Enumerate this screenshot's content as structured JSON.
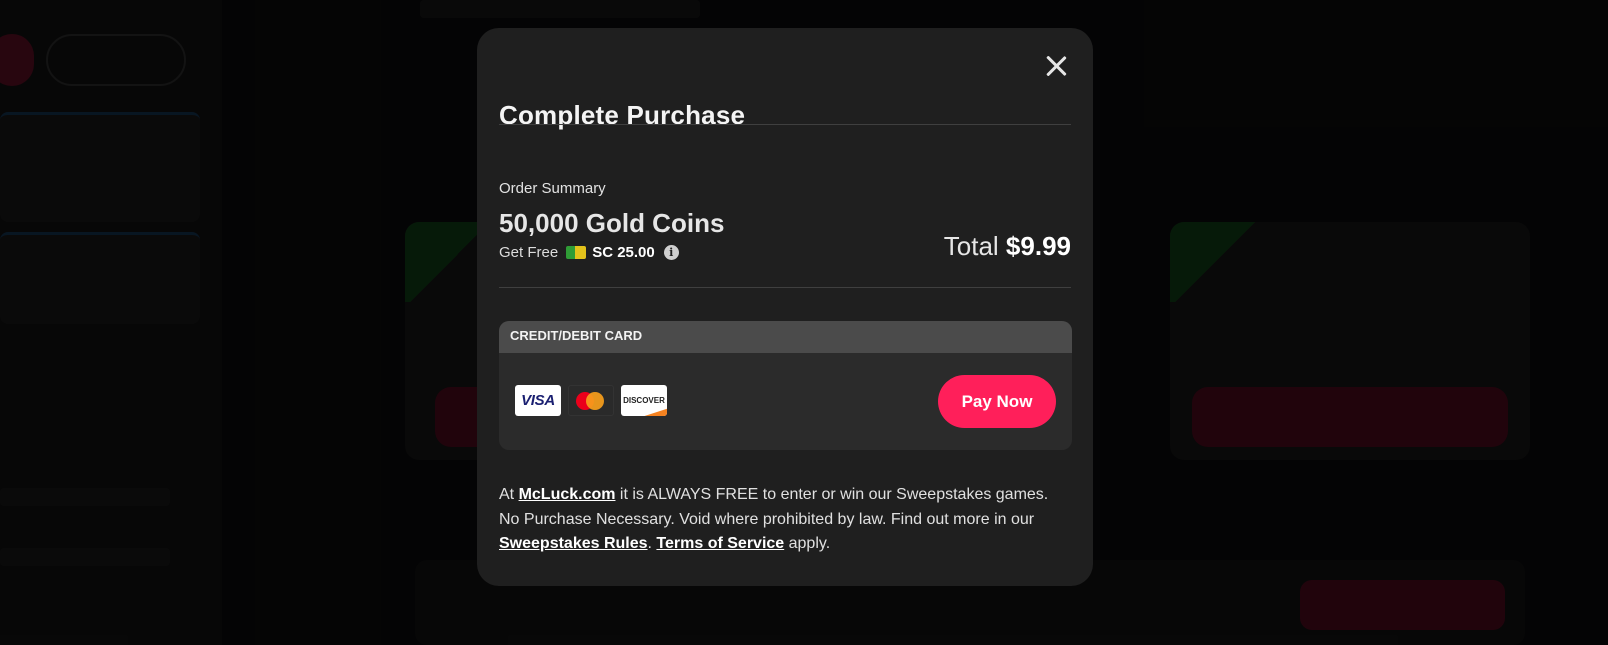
{
  "modal": {
    "title": "Complete Purchase",
    "order_summary_label": "Order Summary",
    "product_name": "50,000 Gold Coins",
    "bonus_prefix": "Get Free",
    "bonus_amount": "SC 25.00",
    "total_label": "Total",
    "total_amount": "$9.99",
    "payment_section_label": "CREDIT/DEBIT CARD",
    "card_brands": [
      "VISA",
      "Mastercard",
      "DISCOVER"
    ],
    "pay_button_label": "Pay Now",
    "disclaimer": {
      "part1": "At ",
      "site_link": "McLuck.com",
      "part2": " it is ALWAYS FREE to enter or win our Sweepstakes games. No Purchase Necessary. Void where prohibited by law. Find out more in our ",
      "rules_link": "Sweepstakes Rules",
      "part3": ". ",
      "terms_link": "Terms of Service",
      "part4": " apply."
    }
  },
  "colors": {
    "modal_bg": "#1f1f1f",
    "pay_button": "#ff1f5a",
    "payment_header": "#4b4b4b",
    "payment_body": "#2b2b2b"
  }
}
